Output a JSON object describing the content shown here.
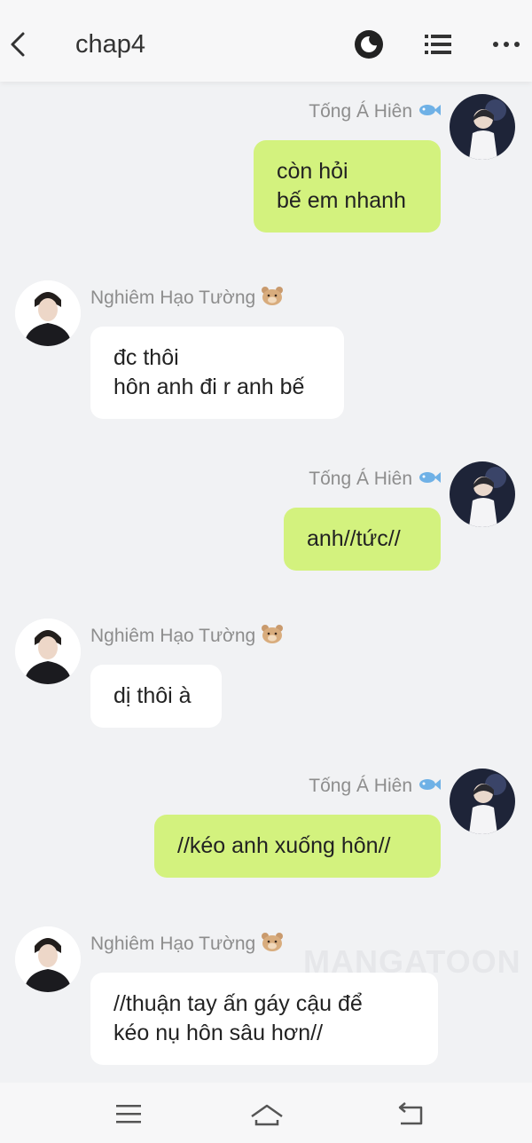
{
  "header": {
    "title": "chap4"
  },
  "watermark": "MANGATOON",
  "messages": [
    {
      "side": "right",
      "name": "Tống Á Hiên",
      "emoji": "fish-icon",
      "text": "còn hỏi\nbế em nhanh"
    },
    {
      "side": "left",
      "name": "Nghiêm Hạo Tường",
      "emoji": "bear-icon",
      "text": "đc thôi\nhôn anh đi r anh bế"
    },
    {
      "side": "right",
      "name": "Tống Á Hiên",
      "emoji": "fish-icon",
      "text": "anh//tức//"
    },
    {
      "side": "left",
      "name": "Nghiêm Hạo Tường",
      "emoji": "bear-icon",
      "text": "dị thôi à"
    },
    {
      "side": "right",
      "name": "Tống Á Hiên",
      "emoji": "fish-icon",
      "text": "//kéo anh xuống hôn//"
    },
    {
      "side": "left",
      "name": "Nghiêm Hạo Tường",
      "emoji": "bear-icon",
      "text": "//thuận tay ấn gáy cậu để\nkéo nụ hôn sâu hơn//"
    }
  ],
  "colors": {
    "right_bubble": "#d3f27e",
    "left_bubble": "#ffffff",
    "background": "#f1f2f4"
  }
}
